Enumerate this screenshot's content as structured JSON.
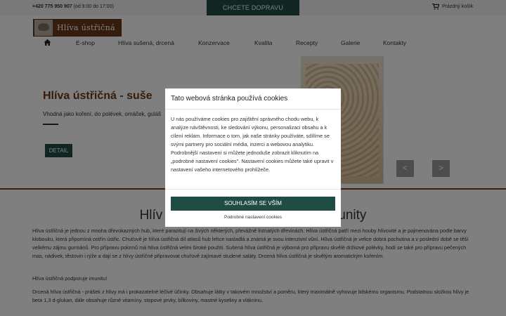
{
  "topbar": {
    "phone": "+420 775 950 907",
    "hours": "(od 9:00 do 17:00)",
    "promo": "CHCETE DOPRAVU ZDARMA?",
    "cart_label": "Prázdný košík",
    "cart_icon": "cart-icon"
  },
  "header": {
    "logo_text": "Hlíva ústřičná",
    "nav": [
      "E-shop",
      "Hlíva sušená, drcená",
      "Konzervace",
      "Kvalita",
      "Recepty",
      "Galerie",
      "Kontakty"
    ],
    "home_icon": "home-icon"
  },
  "hero": {
    "title": "Hlíva ústřičná - suše",
    "subtitle": "Vhodná jako koření, do polévek, omáček, guláš",
    "detail_button": "DETAIL",
    "prev_arrow": "<",
    "next_arrow": ">"
  },
  "content": {
    "title_left": "Hlív",
    "title_right": "unity",
    "paragraphs": [
      "Hlíva ústřičná je jednou z mnoha dřevokazných hub, které parazitují na živých některých, převážně listnatých dřevinách. Hlíva ústřičná patří mezi houby hlívovité a je pojmenována podle barvy klobouku, která připomíná ostřín ústřic. Chuťově je hlíva ústřičná díl atlasů hub lehce nasladlá a známá je svou intenzivní vůní. Hlíva ústřičná je velice dobrá pochutina a v poslední době se těší velkému zájmu gurmánů. Pro přípravu pokrmů má hlíva ústřičná velmi široké použití. Sušená hlíva ústřičná je výborná pro přípravu skvělé držkové polévky, hodí se také pro přípravu pečených mas, nádivek, těstovin i rýže a dají se z hlívy ústřičné připravovat chuťově zajímavé studené saláty. Drcená hlíva ústřičná je skvělým aromatickým kořením.",
      "Hlíva ústřičná podporuje imunitu!",
      "Drcená hlíva ústřičná - prášek z hlívy má i prokazatelné léčivé účinky. Obsahuje látky v takovém množství a poměru, který maximálně vyhovuje lidskému organismu. Podstatnou složkou hlívy je beta 1,3 d-glukan, dále obsahuje různé vitamíny, stopové prvky, bílkoviny, mastné kyseliny a vlákninu."
    ]
  },
  "cookie_modal": {
    "title": "Tato webová stránka používá cookies",
    "text": "U nás používáme cookies pro zajištění správného chodu webu, k analýze návštěvnosti, ke sledování výkonu, personalizaci obsahu a k cílení reklam. Informace o tom, jak naše stránky používáte, sdílíme se svými partnery pro sociální média, inzerci a webovou analytiku. Podrobnější nastavení si můžete jednoduše zobrazit kliknutím na „podrobné nastavení cookies\". Nastavení cookies můžete také upravit v nastavení vašeho internetového prohlížeče.",
    "accept_button": "SOUHLASÍM SE VŠÍM",
    "settings_link": "Podrobné nastavení cookies"
  },
  "colors": {
    "brand_green": "#1f4d44",
    "brand_brown": "#6b3a1a"
  }
}
